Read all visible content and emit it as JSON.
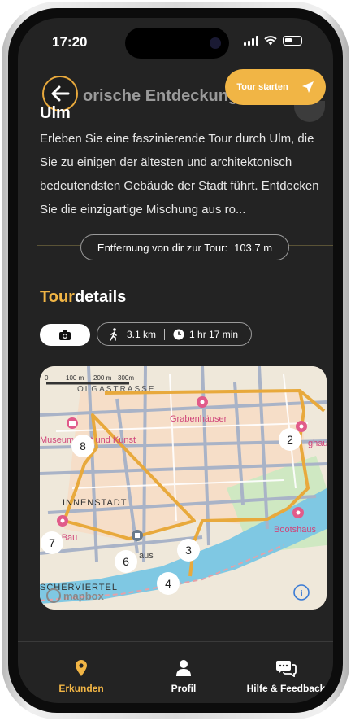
{
  "status": {
    "time": "17:20"
  },
  "header": {
    "title_partial": "orische Entdeckung",
    "start_button": "Tour starten"
  },
  "tour": {
    "city": "Ulm",
    "description": "Erleben Sie eine faszinierende Tour durch Ulm, die Sie zu einigen der ältesten und architektonisch bedeutendsten Gebäude der Stadt führt. Entdecken Sie die einzigartige Mischung aus ro...",
    "distance_label": "Entfernung von dir zur Tour:",
    "distance_value": "103.7 m"
  },
  "details": {
    "title_accent": "Tour",
    "title_rest": "details",
    "length": "3.1 km",
    "duration": "1 hr 17 min"
  },
  "map": {
    "scale": {
      "l0": "0",
      "l100": "100 m",
      "l200": "200 m",
      "l300": "300m"
    },
    "street": "OLGASTRASSE",
    "district_1": "INNENSTADT",
    "district_2": "SCHERVIERTEL",
    "poi_grabenhaeuser": "Grabenhäuser",
    "poi_museum": "Museum Brot und Kunst",
    "poi_bootshaus": "Bootshaus",
    "poi_zeughaus": "ghaus",
    "poi_bau": "r Bau",
    "poi_haus": "aus",
    "attribution": "mapbox",
    "stops": [
      "2",
      "3",
      "4",
      "6",
      "7",
      "8"
    ],
    "route_color": "#e8a93c"
  },
  "tabs": [
    {
      "label": "Erkunden",
      "icon": "location-pin-icon",
      "active": true
    },
    {
      "label": "Profil",
      "icon": "person-icon",
      "active": false
    },
    {
      "label": "Hilfe & Feedback",
      "icon": "chat-bubbles-icon",
      "active": false
    }
  ],
  "colors": {
    "accent": "#f1b545",
    "background": "#232323"
  }
}
